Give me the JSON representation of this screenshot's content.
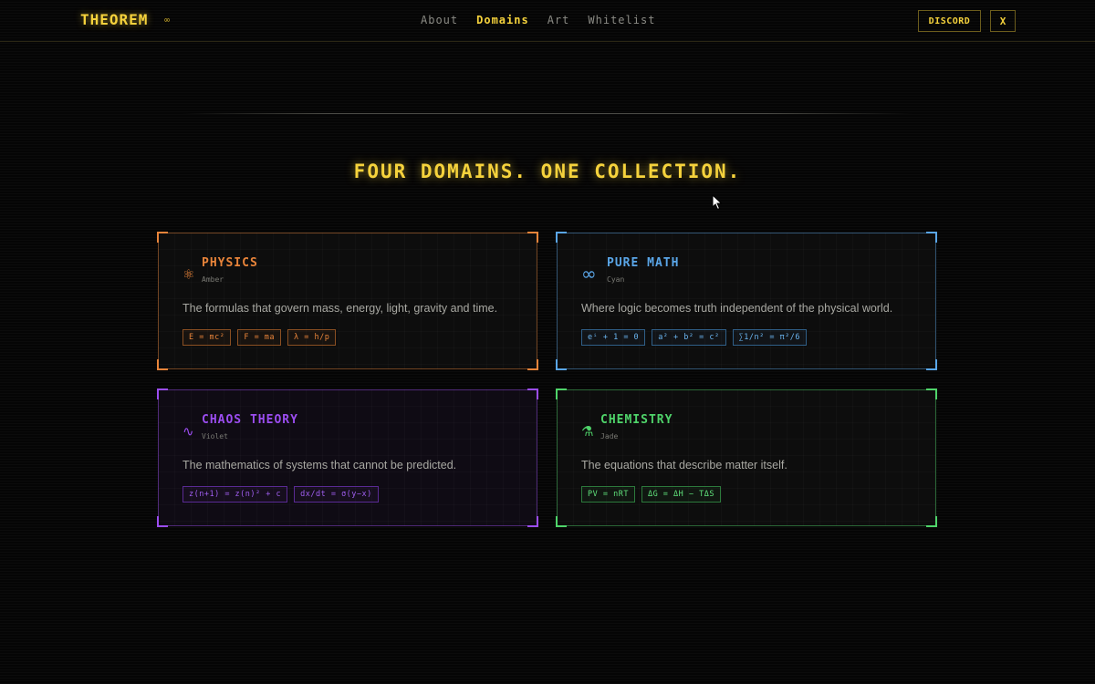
{
  "nav": {
    "logo": "THEOREM",
    "logo_symbol": "∞",
    "links": [
      {
        "label": "About",
        "active": false
      },
      {
        "label": "Domains",
        "active": true
      },
      {
        "label": "Art",
        "active": false
      },
      {
        "label": "Whitelist",
        "active": false
      }
    ],
    "discord_label": "DISCORD",
    "x_label": "X"
  },
  "headline": "FOUR DOMAINS. ONE COLLECTION.",
  "cards": [
    {
      "icon": "⚛",
      "icon_name": "atom-icon",
      "title": "PHYSICS",
      "subtitle": "Amber",
      "description": "The formulas that govern mass, energy, light, gravity and time.",
      "chips": [
        "E = mc²",
        "F = ma",
        "λ = h/p"
      ],
      "color": "#e8843a"
    },
    {
      "icon": "∞",
      "icon_name": "infinity-icon",
      "title": "PURE MATH",
      "subtitle": "Cyan",
      "description": "Where logic becomes truth independent of the physical world.",
      "chips": [
        "eⁱ + 1 = 0",
        "a² + b² = c²",
        "∑1/n² = π²/6"
      ],
      "color": "#5aa6e8"
    },
    {
      "icon": "∿",
      "icon_name": "wave-icon",
      "title": "CHAOS THEORY",
      "subtitle": "Violet",
      "description": "The mathematics of systems that cannot be predicted.",
      "chips": [
        "z(n+1) = z(n)² + c",
        "dx/dt = σ(y−x)"
      ],
      "color": "#9b4df0"
    },
    {
      "icon": "⚗",
      "icon_name": "flask-icon",
      "title": "CHEMISTRY",
      "subtitle": "Jade",
      "description": "The equations that describe matter itself.",
      "chips": [
        "PV = nRT",
        "ΔG = ΔH − TΔS"
      ],
      "color": "#4fd46a"
    }
  ]
}
